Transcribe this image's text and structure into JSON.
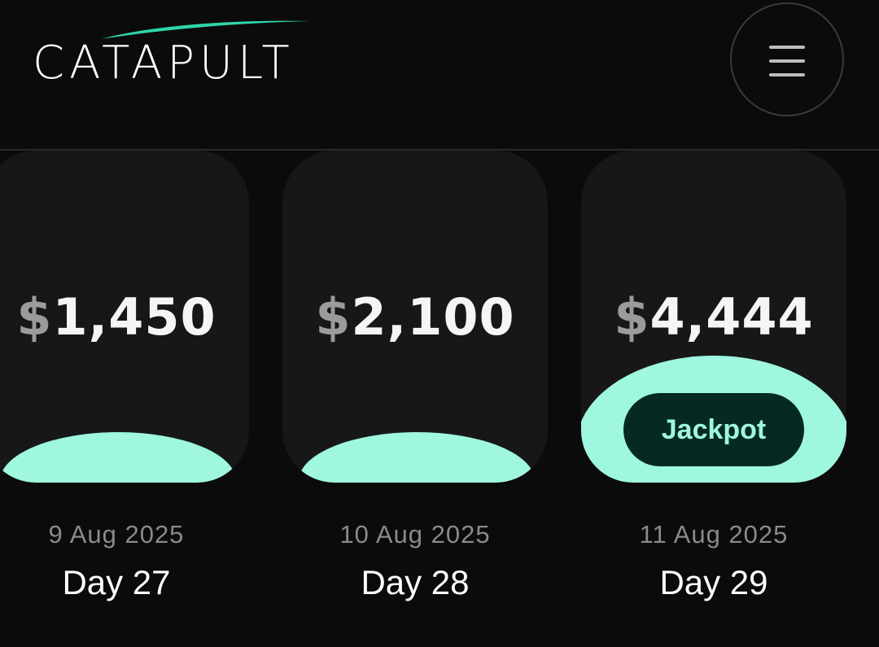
{
  "brand": {
    "name": "CATAPULT",
    "accent_color": "#9ef7de",
    "swoosh_color": "#2fd6a9"
  },
  "header": {
    "menu_icon": "hamburger-menu-icon"
  },
  "cards": [
    {
      "currency": "$",
      "amount": "1,450",
      "date": "9 Aug 2025",
      "day": "Day 27",
      "jackpot": false
    },
    {
      "currency": "$",
      "amount": "2,100",
      "date": "10 Aug 2025",
      "day": "Day 28",
      "jackpot": false
    },
    {
      "currency": "$",
      "amount": "4,444",
      "date": "11 Aug 2025",
      "day": "Day 29",
      "jackpot": true,
      "badge_label": "Jackpot"
    }
  ]
}
